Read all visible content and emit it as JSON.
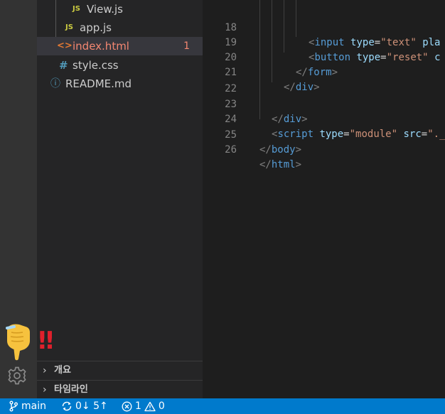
{
  "explorer": {
    "files": [
      {
        "label": "View.js",
        "icon": "JS",
        "kind": "js"
      },
      {
        "label": "app.js",
        "icon": "JS",
        "kind": "js"
      },
      {
        "label": "index.html",
        "icon": "<>",
        "kind": "html",
        "badge": "1"
      },
      {
        "label": "style.css",
        "icon": "#",
        "kind": "css"
      },
      {
        "label": "README.md",
        "icon": "ⓘ",
        "kind": "info"
      }
    ],
    "sections": [
      {
        "label": "개요"
      },
      {
        "label": "타임라인"
      }
    ]
  },
  "annotation": {
    "emoji": "👇",
    "marks": "‼"
  },
  "editor": {
    "lines": [
      {
        "num": "18"
      },
      {
        "num": "19"
      },
      {
        "num": "20"
      },
      {
        "num": "21"
      },
      {
        "num": "22"
      },
      {
        "num": "23"
      },
      {
        "num": "24"
      },
      {
        "num": "25"
      },
      {
        "num": "26"
      }
    ],
    "code": {
      "l18": {
        "open": "<",
        "tag": "input",
        "attr1": "type",
        "eq": "=",
        "val1": "\"text\"",
        "rest": "pla"
      },
      "l19": {
        "open": "<",
        "tag": "button",
        "attr1": "type",
        "eq": "=",
        "val1": "\"reset\"",
        "rest": "c"
      },
      "l20": {
        "open": "</",
        "tag": "form",
        "close": ">"
      },
      "l21": {
        "open": "</",
        "tag": "div",
        "close": ">"
      },
      "l23": {
        "open": "</",
        "tag": "div",
        "close": ">"
      },
      "l24": {
        "open": "<",
        "tag": "script",
        "attr1": "type",
        "eq": "=",
        "val1": "\"module\"",
        "attr2": "src",
        "eq2": "=",
        "val2": "\"._"
      },
      "l25": {
        "open": "</",
        "tag": "body",
        "close": ">"
      },
      "l26": {
        "open": "</",
        "tag": "html",
        "close": ">"
      }
    }
  },
  "statusbar": {
    "branch": "main",
    "sync": "0↓ 5↑",
    "errors": "1",
    "warnings": "0"
  },
  "colors": {
    "statusbar": "#007acc",
    "activity_bar": "#333333",
    "sidebar": "#252526",
    "editor": "#1e1e1e",
    "error_file": "#f48771"
  }
}
